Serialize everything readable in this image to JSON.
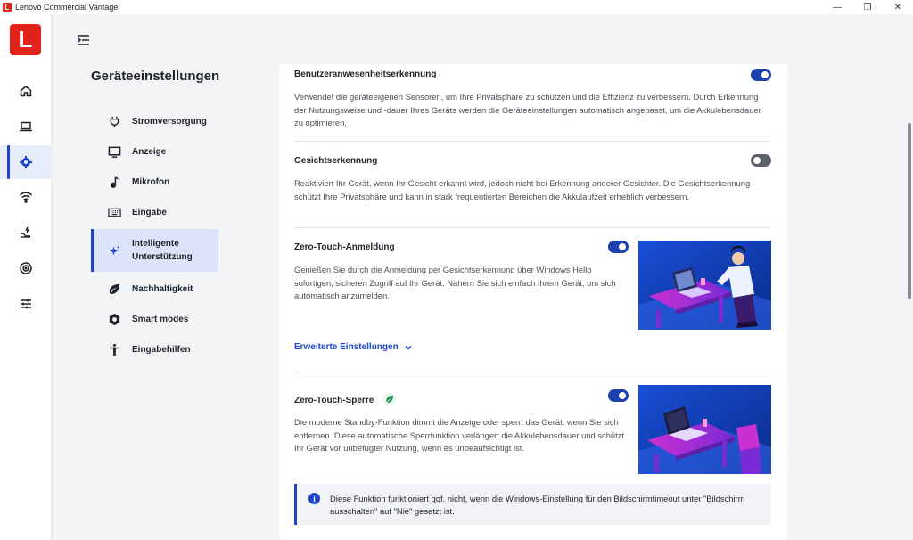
{
  "window": {
    "title": "Lenovo Commercial Vantage",
    "app_icon_letter": "L",
    "minimize": "—",
    "maximize": "❐",
    "close": "✕"
  },
  "rail": {
    "logo_letter": "L",
    "items": [
      {
        "icon": "home-icon"
      },
      {
        "icon": "laptop-icon"
      },
      {
        "icon": "gear-icon",
        "active": true
      },
      {
        "icon": "wifi-icon"
      },
      {
        "icon": "battery-charge-icon"
      },
      {
        "icon": "target-icon"
      },
      {
        "icon": "sliders-icon"
      }
    ]
  },
  "subnav": {
    "title": "Geräteeinstellungen",
    "items": [
      {
        "label": "Stromversorgung",
        "icon": "plug-icon"
      },
      {
        "label": "Anzeige",
        "icon": "monitor-icon"
      },
      {
        "label": "Mikrofon",
        "icon": "microphone-icon"
      },
      {
        "label": "Eingabe",
        "icon": "keyboard-icon"
      },
      {
        "label": "Intelligente Unterstützung",
        "icon": "sparkle-icon",
        "active": true
      },
      {
        "label": "Nachhaltigkeit",
        "icon": "leaf-icon"
      },
      {
        "label": "Smart modes",
        "icon": "hexagon-icon"
      },
      {
        "label": "Eingabehilfen",
        "icon": "accessibility-icon"
      }
    ]
  },
  "main": {
    "presence": {
      "title": "Benutzeranwesenheitserkennung",
      "desc": "Verwendet die geräteeigenen Sensoren, um Ihre Privatsphäre zu schützen und die Effizienz zu verbessern. Durch Erkennung der Nutzungsweise und -dauer Ihres Geräts werden die Geräteeinstellungen automatisch angepasst, um die Akkulebensdauer zu optimieren.",
      "enabled": true
    },
    "face": {
      "title": "Gesichtserkennung",
      "desc": "Reaktiviert Ihr Gerät, wenn Ihr Gesicht erkannt wird, jedoch nicht bei Erkennung anderer Gesichter. Die Gesichtserkennung schützt Ihre Privatsphäre und kann in stark frequentierten Bereichen die Akkulaufzeit erheblich verbessern.",
      "enabled": false
    },
    "zero_login": {
      "title": "Zero-Touch-Anmeldung",
      "desc": "Genießen Sie durch die Anmeldung per Gesichtserkennung über Windows Hello sofortigen, sicheren Zugriff auf Ihr Gerät. Nähern Sie sich einfach Ihrem Gerät, um sich automatisch anzumelden.",
      "enabled": true,
      "advanced_link": "Erweiterte Einstellungen"
    },
    "zero_lock": {
      "title": "Zero-Touch-Sperre",
      "desc": "Die moderne Standby-Funktion dimmt die Anzeige oder sperrt das Gerät, wenn Sie sich entfernen. Diese automatische Sperrfunktion verlängert die Akkulebensdauer und schützt Ihr Gerät vor unbefugter Nutzung, wenn es unbeaufsichtigt ist.",
      "enabled": true
    },
    "info": {
      "icon_text": "i",
      "text": "Diese Funktion funktioniert ggf. nicht, wenn die Windows-Einstellung für den Bildschirmtimeout unter \"Bildschirm ausschalten\" auf \"Nie\" gesetzt ist."
    }
  },
  "colors": {
    "accent": "#1d45c9",
    "brand_red": "#e2231a",
    "toggle_on": "#1d3faf",
    "toggle_off": "#5c6068"
  }
}
